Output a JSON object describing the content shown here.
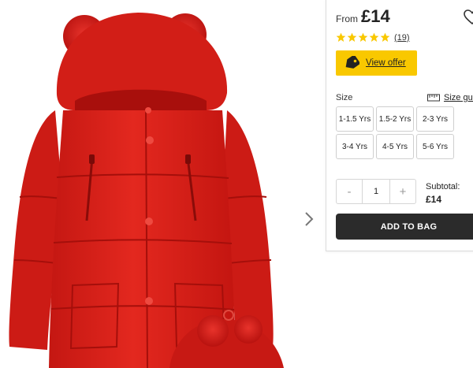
{
  "product": {
    "image_alt": "Red padded coat with bear ears and matching hat"
  },
  "gallery": {
    "next_icon": "chevron-right-icon"
  },
  "price": {
    "from_label": "From",
    "value": "£14"
  },
  "wishlist": {
    "icon": "heart-icon"
  },
  "rating": {
    "stars": 5,
    "review_count": "(19)",
    "star_color": "#f9c800"
  },
  "offer": {
    "label": "View offer",
    "icon": "price-tag-icon",
    "color": "#f9c800"
  },
  "size": {
    "label": "Size",
    "guide_label": "Size guide",
    "guide_icon": "ruler-icon",
    "options": [
      "1-1.5 Yrs",
      "1.5-2 Yrs",
      "2-3 Yrs",
      "3-4 Yrs",
      "4-5 Yrs",
      "5-6 Yrs"
    ]
  },
  "quantity": {
    "minus": "-",
    "value": "1",
    "plus": "+"
  },
  "subtotal": {
    "label": "Subtotal:",
    "value": "£14"
  },
  "cart": {
    "add_label": "ADD TO BAG",
    "button_color": "#2b2b2b"
  }
}
